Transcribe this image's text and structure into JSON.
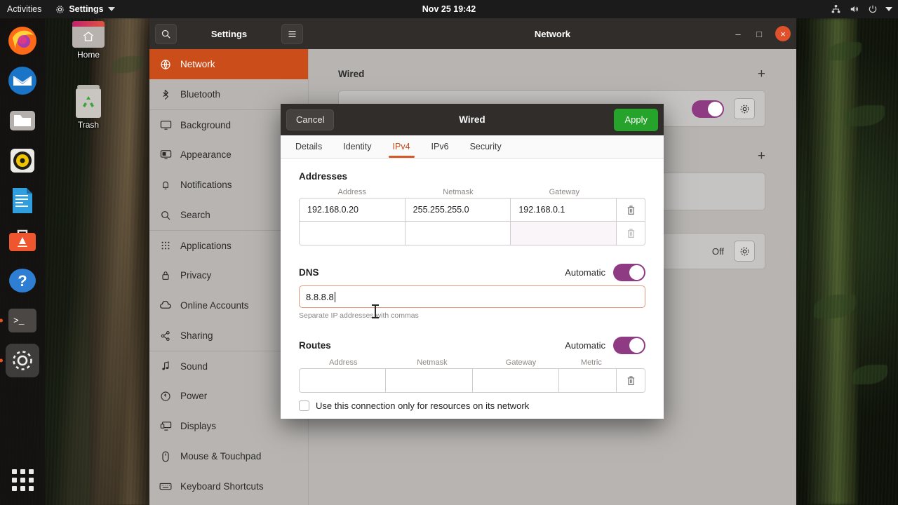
{
  "topbar": {
    "activities": "Activities",
    "app_menu": "Settings",
    "app_menu_icon": "gear-icon",
    "clock": "Nov 25  19:42",
    "indicators": [
      "network-icon",
      "volume-icon",
      "power-icon",
      "chevron-down-icon"
    ]
  },
  "dock": {
    "items": [
      {
        "name": "firefox",
        "label": "Firefox",
        "running": false
      },
      {
        "name": "thunderbird",
        "label": "Thunderbird",
        "running": false
      },
      {
        "name": "files",
        "label": "Files",
        "running": false
      },
      {
        "name": "rhythmbox",
        "label": "Rhythmbox",
        "running": false
      },
      {
        "name": "libreoffice-writer",
        "label": "LibreOffice Writer",
        "running": false
      },
      {
        "name": "ubuntu-software",
        "label": "Ubuntu Software",
        "running": false
      },
      {
        "name": "help",
        "label": "Help",
        "running": false
      },
      {
        "name": "terminal",
        "label": "Terminal",
        "running": true
      },
      {
        "name": "settings",
        "label": "Settings",
        "running": true
      }
    ],
    "show_apps_label": "Show Applications"
  },
  "desktop": {
    "icons": [
      {
        "name": "home",
        "label": "Home"
      },
      {
        "name": "trash",
        "label": "Trash"
      }
    ]
  },
  "settings_window": {
    "sidebar_title": "Settings",
    "content_title": "Network",
    "search_icon": "search-icon",
    "menu_icon": "hamburger-menu-icon",
    "window_controls": {
      "minimize": "–",
      "maximize": "□",
      "close": "×"
    },
    "sidebar_items": [
      {
        "label": "Network",
        "icon": "globe-icon",
        "active": true,
        "separator": false
      },
      {
        "label": "Bluetooth",
        "icon": "bluetooth-icon",
        "active": false,
        "separator": false
      },
      {
        "label": "Background",
        "icon": "monitor-icon",
        "active": false,
        "separator": true
      },
      {
        "label": "Appearance",
        "icon": "appearance-icon",
        "active": false,
        "separator": false
      },
      {
        "label": "Notifications",
        "icon": "bell-icon",
        "active": false,
        "separator": false
      },
      {
        "label": "Search",
        "icon": "search-icon",
        "active": false,
        "separator": false
      },
      {
        "label": "Applications",
        "icon": "apps-grid-icon",
        "active": false,
        "separator": true
      },
      {
        "label": "Privacy",
        "icon": "lock-icon",
        "active": false,
        "separator": false
      },
      {
        "label": "Online Accounts",
        "icon": "cloud-icon",
        "active": false,
        "separator": false
      },
      {
        "label": "Sharing",
        "icon": "share-icon",
        "active": false,
        "separator": false
      },
      {
        "label": "Sound",
        "icon": "music-note-icon",
        "active": false,
        "separator": true
      },
      {
        "label": "Power",
        "icon": "power-icon",
        "active": false,
        "separator": false
      },
      {
        "label": "Displays",
        "icon": "displays-icon",
        "active": false,
        "separator": false
      },
      {
        "label": "Mouse & Touchpad",
        "icon": "mouse-icon",
        "active": false,
        "separator": false
      },
      {
        "label": "Keyboard Shortcuts",
        "icon": "keyboard-icon",
        "active": false,
        "separator": false
      }
    ],
    "network_page": {
      "sections": [
        {
          "title": "Wired",
          "add_icon": "plus-icon",
          "toggle_on": true,
          "status": "",
          "gear_icon": "gear-icon"
        },
        {
          "title": "",
          "add_icon": "plus-icon",
          "toggle_on": false,
          "status": "Off",
          "gear_icon": "gear-icon"
        }
      ]
    }
  },
  "dialog": {
    "title": "Wired",
    "cancel_label": "Cancel",
    "apply_label": "Apply",
    "tabs": [
      {
        "label": "Details",
        "active": false
      },
      {
        "label": "Identity",
        "active": false
      },
      {
        "label": "IPv4",
        "active": true
      },
      {
        "label": "IPv6",
        "active": false
      },
      {
        "label": "Security",
        "active": false
      }
    ],
    "addresses": {
      "title": "Addresses",
      "columns": [
        "Address",
        "Netmask",
        "Gateway"
      ],
      "rows": [
        {
          "address": "192.168.0.20",
          "netmask": "255.255.255.0",
          "gateway": "192.168.0.1",
          "delete_icon": "trash-icon"
        },
        {
          "address": "",
          "netmask": "",
          "gateway": "",
          "delete_icon": "trash-icon"
        }
      ]
    },
    "dns": {
      "title": "DNS",
      "automatic_label": "Automatic",
      "automatic_on": true,
      "value": "8.8.8.8",
      "hint": "Separate IP addresses with commas",
      "focused": true
    },
    "routes": {
      "title": "Routes",
      "automatic_label": "Automatic",
      "automatic_on": true,
      "columns": [
        "Address",
        "Netmask",
        "Gateway",
        "Metric"
      ],
      "rows": [
        {
          "address": "",
          "netmask": "",
          "gateway": "",
          "metric": "",
          "delete_icon": "trash-icon"
        }
      ]
    },
    "restrict_checkbox": {
      "label": "Use this connection only for resources on its network",
      "checked": false
    }
  },
  "colors": {
    "accent_orange": "#cb4d1a",
    "apply_green": "#26a32a",
    "toggle_purple": "#8e3b84",
    "focus_border": "#e09a7d",
    "header_dark": "#302d2b",
    "sidebar_gray": "#b7b4b1"
  }
}
